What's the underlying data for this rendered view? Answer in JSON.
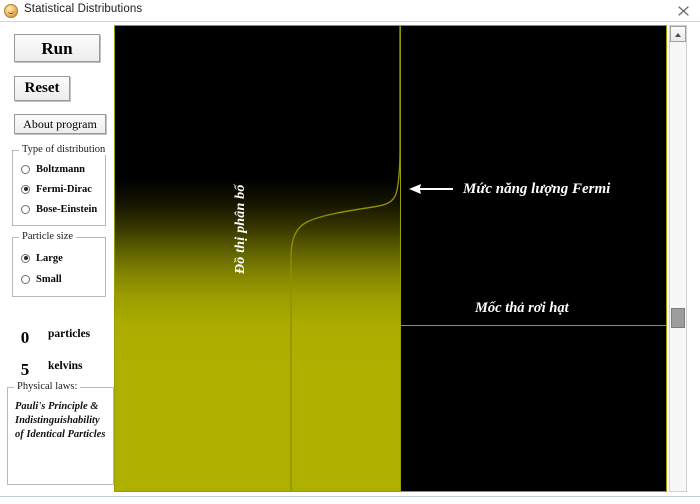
{
  "window": {
    "title": "Statistical Distributions",
    "icon": "app-smiley-icon",
    "close_label": "close-icon"
  },
  "sidebar": {
    "buttons": [
      {
        "name": "run",
        "label": "Run"
      },
      {
        "name": "reset",
        "label": "Reset"
      },
      {
        "name": "about",
        "label": "About program"
      }
    ],
    "distribution_group": {
      "legend": "Type of distribution",
      "options": [
        {
          "label": "Boltzmann",
          "selected": false
        },
        {
          "label": "Fermi-Dirac",
          "selected": true
        },
        {
          "label": "Bose-Einstein",
          "selected": false
        }
      ]
    },
    "particle_size_group": {
      "legend": "Particle size",
      "options": [
        {
          "label": "Large",
          "selected": true
        },
        {
          "label": "Small",
          "selected": false
        }
      ]
    },
    "counters": [
      {
        "value": "0",
        "unit": "particles"
      },
      {
        "value": "5",
        "unit": "kelvins"
      }
    ],
    "physical_laws_group": {
      "legend": "Physical laws:",
      "text": "Pauli's Principle & Indistinguishability of Identical Particles"
    }
  },
  "canvas": {
    "fermi_level_label": "Mức năng lượng Fermi",
    "drop_level_label": "Mốc thả rơi hạt",
    "distribution_axis_label": "Đồ thị phân bố",
    "colors": {
      "fill": "#aeb000",
      "background": "#000000",
      "line": "#9a9c00",
      "annotation_text": "#ffffff"
    }
  },
  "scrollbar": {
    "up_arrow": "scroll-up-arrow",
    "thumb": "scroll-thumb"
  }
}
